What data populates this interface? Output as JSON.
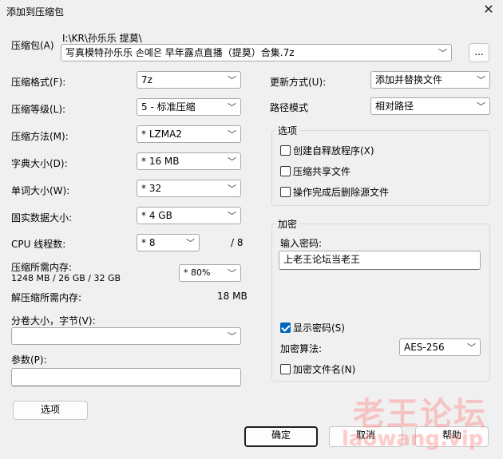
{
  "window": {
    "title": "添加到压缩包"
  },
  "archive": {
    "label": "压缩包(A)",
    "path": "I:\\KR\\孙乐乐 提莫\\",
    "filename": "写真模特孙乐乐 손예은 早年露点直播（提莫）合集.7z",
    "browse_label": "..."
  },
  "left": {
    "format": {
      "label": "压缩格式(F):",
      "value": "7z"
    },
    "level": {
      "label": "压缩等级(L):",
      "value": "5 - 标准压缩"
    },
    "method": {
      "label": "压缩方法(M):",
      "value": "* LZMA2"
    },
    "dict": {
      "label": "字典大小(D):",
      "value": "* 16 MB"
    },
    "word": {
      "label": "单词大小(W):",
      "value": "* 32"
    },
    "solid": {
      "label": "固实数据大小:",
      "value": "* 4 GB"
    },
    "threads": {
      "label": "CPU 线程数:",
      "value": "* 8",
      "max": "/ 8"
    },
    "mem_compress": {
      "label": "压缩所需内存:",
      "detail": "1248 MB / 26 GB / 32 GB",
      "value": "* 80%"
    },
    "mem_decompress": {
      "label": "解压缩所需内存:",
      "value": "18 MB"
    },
    "split": {
      "label": "分卷大小，字节(V):",
      "value": ""
    },
    "params": {
      "label": "参数(P):",
      "value": ""
    },
    "options_button": "选项"
  },
  "right": {
    "update": {
      "label": "更新方式(U):",
      "value": "添加并替换文件"
    },
    "path_mode": {
      "label": "路径模式",
      "value": "相对路径"
    },
    "options_group": {
      "title": "选项",
      "items": [
        {
          "label": "创建自释放程序(X)",
          "checked": false
        },
        {
          "label": "压缩共享文件",
          "checked": false
        },
        {
          "label": "操作完成后删除源文件",
          "checked": false
        }
      ]
    },
    "encrypt_group": {
      "title": "加密",
      "password_label": "输入密码:",
      "password_value": "上老王论坛当老王",
      "show_password": {
        "label": "显示密码(S)",
        "checked": true
      },
      "method_label": "加密算法:",
      "method_value": "AES-256",
      "encrypt_names": {
        "label": "加密文件名(N)",
        "checked": false
      }
    }
  },
  "buttons": {
    "ok": "确定",
    "cancel": "取消",
    "help": "帮助"
  },
  "watermark": {
    "line1": "老王论坛",
    "line2": "laowang.vip"
  }
}
